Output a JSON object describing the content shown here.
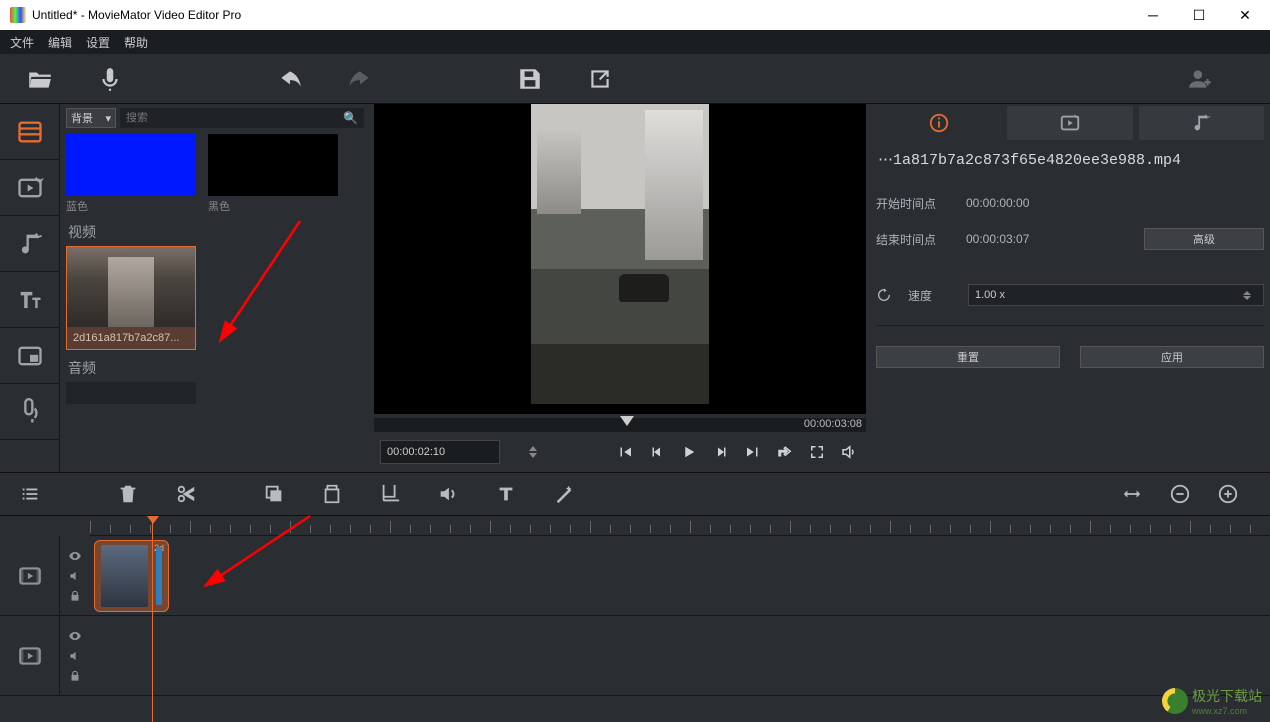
{
  "titlebar": {
    "title": "Untitled* - MovieMator Video Editor Pro"
  },
  "menu": {
    "file": "文件",
    "edit": "编辑",
    "settings": "设置",
    "help": "帮助"
  },
  "media": {
    "dropdown": "背景",
    "search_placeholder": "搜索",
    "blue": "蓝色",
    "black": "黑色",
    "video_section": "视频",
    "clip_name": "2d161a817b7a2c87...",
    "audio_section": "音频"
  },
  "preview": {
    "duration": "00:00:03:08",
    "timecode": "00:00:02:10"
  },
  "inspector": {
    "filename": "⋯1a817b7a2c873f65e4820ee3e988.mp4",
    "start_label": "开始时间点",
    "start_value": "00:00:00:00",
    "end_label": "结束时间点",
    "end_value": "00:00:03:07",
    "advanced": "高级",
    "speed_label": "速度",
    "speed_value": "1.00 x",
    "reset": "重置",
    "apply": "应用"
  },
  "timeline": {
    "clip_label": "2d"
  },
  "watermark": {
    "text": "极光下载站",
    "url": "www.xz7.com"
  }
}
